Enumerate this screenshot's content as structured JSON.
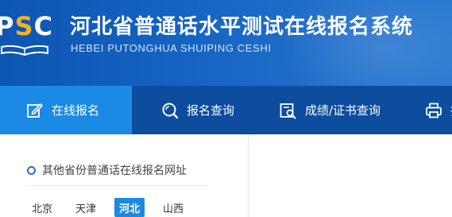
{
  "header": {
    "logo_text_left": "P",
    "logo_text_accent": "S",
    "logo_text_right": "C",
    "logo_icon": "open-book-icon",
    "title": "河北省普通话水平测试在线报名系统",
    "subtitle": "HEBEI PUTONGHUA SHUIPING CESHI",
    "colors": {
      "header_bg": "#1463c2",
      "logo_accent": "#f5b31b"
    }
  },
  "nav": {
    "items": [
      {
        "label": "在线报名",
        "icon": "edit-icon",
        "active": true
      },
      {
        "label": "报名查询",
        "icon": "search-icon",
        "active": false
      },
      {
        "label": "成绩/证书查询",
        "icon": "certificate-search-icon",
        "active": false
      },
      {
        "label": "打",
        "icon": "printer-icon",
        "active": false
      }
    ],
    "colors": {
      "nav_bg": "#0c4d9e",
      "active_bg": "#1a8ae6"
    }
  },
  "panel": {
    "title": "其他省份普通话在线报名网址",
    "title_icon": "circle-icon",
    "provinces": [
      {
        "label": "北京",
        "active": false
      },
      {
        "label": "天津",
        "active": false
      },
      {
        "label": "河北",
        "active": true
      },
      {
        "label": "山西",
        "active": false
      }
    ]
  }
}
